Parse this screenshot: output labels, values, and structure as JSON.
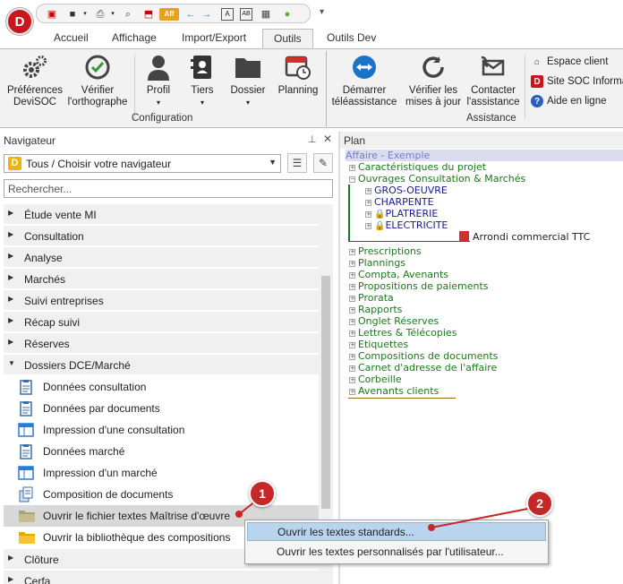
{
  "app": {
    "logo_letter": "D"
  },
  "tabs": [
    {
      "label": "Accueil"
    },
    {
      "label": "Affichage"
    },
    {
      "label": "Import/Export"
    },
    {
      "label": "Outils"
    },
    {
      "label": "Outils Dev"
    }
  ],
  "ribbon": {
    "buttons": [
      {
        "label": "Préférences DeviSOC"
      },
      {
        "label": "Vérifier l'orthographe"
      },
      {
        "label": "Profil"
      },
      {
        "label": "Tiers"
      },
      {
        "label": "Dossier"
      },
      {
        "label": "Planning"
      },
      {
        "label": "Démarrer téléassistance"
      },
      {
        "label": "Vérifier les mises à jour"
      },
      {
        "label": "Contacter l'assistance"
      }
    ],
    "groups": [
      "Configuration",
      "Assistance"
    ],
    "links": [
      {
        "label": "Espace client"
      },
      {
        "label": "Site SOC Informa"
      },
      {
        "label": "Aide en ligne"
      }
    ]
  },
  "navigator": {
    "title": "Navigateur",
    "selector_value": "Tous / Choisir votre navigateur",
    "search_placeholder": "Rechercher...",
    "categories": [
      "Étude vente MI",
      "Consultation",
      "Analyse",
      "Marchés",
      "Suivi entreprises",
      "Récap suivi",
      "Réserves",
      "Dossiers DCE/Marché",
      "Clôture",
      "Cerfa"
    ],
    "items": [
      "Données consultation",
      "Données par documents",
      "Impression d'une consultation",
      "Données marché",
      "Impression d'un marché",
      "Composition de documents",
      "Ouvrir le fichier textes Maîtrise d'œuvre",
      "Ouvrir la bibliothèque des compositions"
    ]
  },
  "plan": {
    "title": "Plan",
    "root": "Affaire - Exemple",
    "nodes": [
      "Caractéristiques du projet",
      "Ouvrages Consultation & Marchés",
      "GROS-OEUVRE",
      "CHARPENTE",
      "PLATRERIE",
      "ELECTRICITE",
      "Arrondi commercial TTC",
      "Prescriptions",
      "Plannings",
      "Compta, Avenants",
      "Propositions de paiements",
      "Prorata",
      "Rapports",
      "Onglet Réserves",
      "Lettres & Télécopies",
      "Etiquettes",
      "Compositions de documents",
      "Carnet d'adresse de l'affaire",
      "Corbeille",
      "Avenants clients"
    ]
  },
  "context_menu": [
    "Ouvrir les textes standards...",
    "Ouvrir les textes personnalisés par l'utilisateur..."
  ],
  "badges": [
    "1",
    "2"
  ]
}
